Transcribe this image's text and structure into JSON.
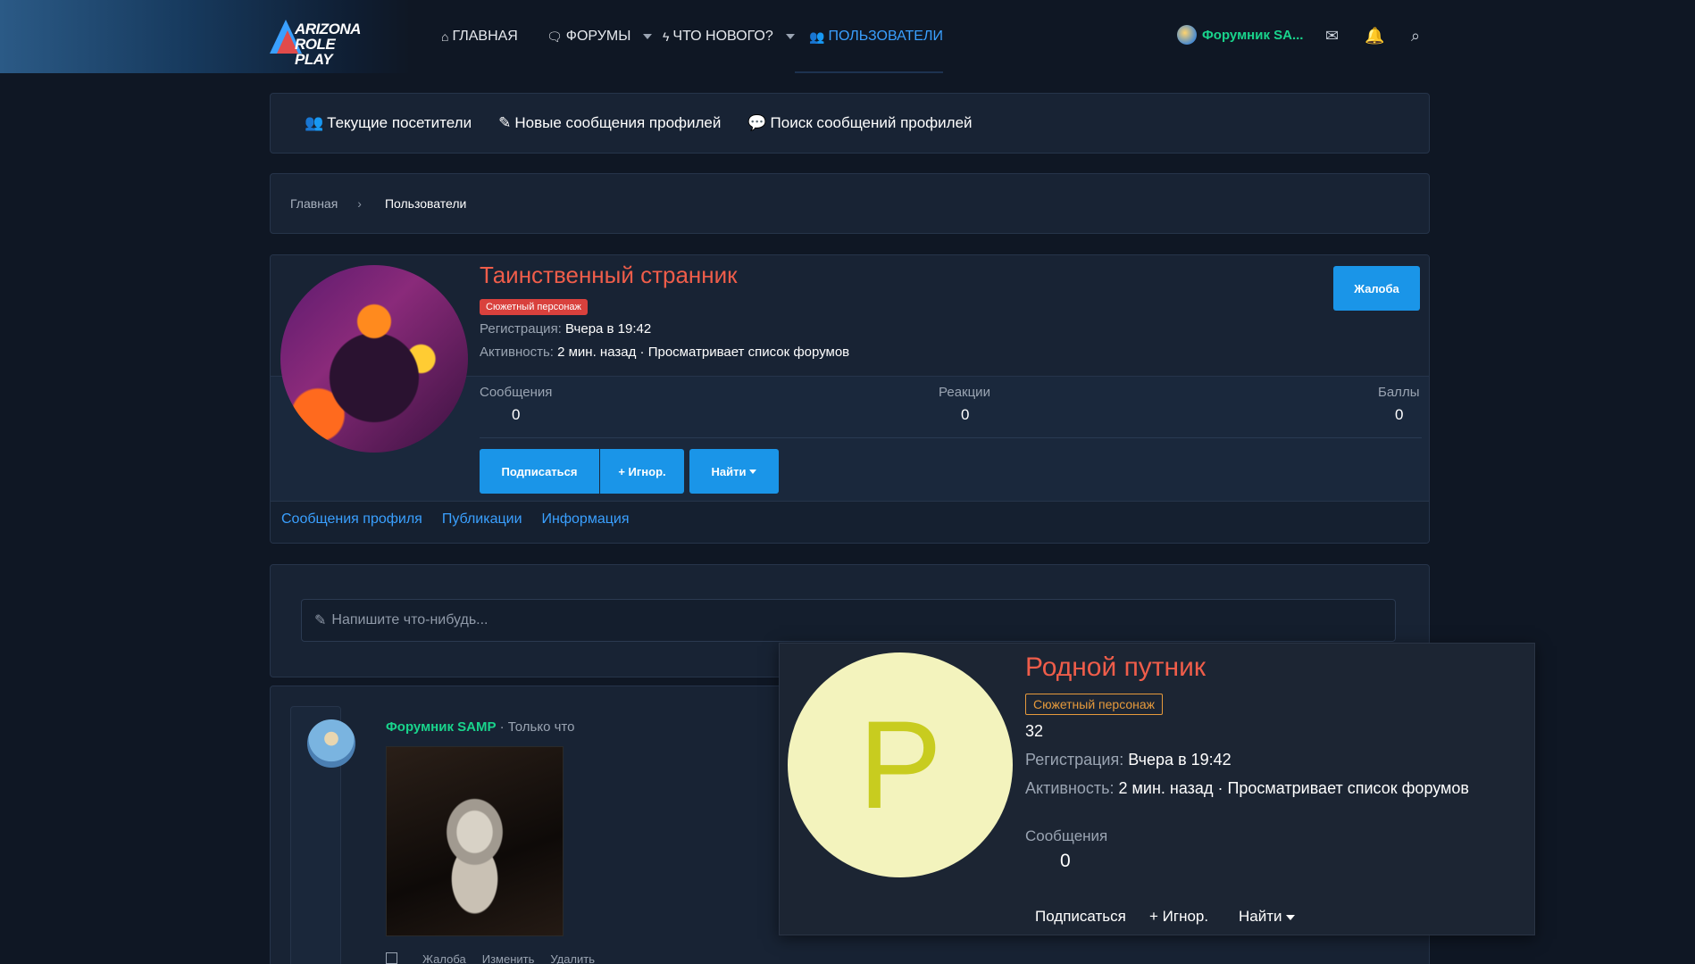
{
  "header": {
    "logo_line1": "ARIZONA",
    "logo_line2": "ROLE PLAY",
    "nav": [
      {
        "label": "ГЛАВНАЯ",
        "icon": "home-icon"
      },
      {
        "label": "ФОРУМЫ",
        "icon": "chat-icon"
      },
      {
        "label": "ЧТО НОВОГО?",
        "icon": "bolt-icon"
      },
      {
        "label": "ПОЛЬЗОВАТЕЛИ",
        "icon": "users-icon"
      }
    ],
    "user_name": "Форумник SA...",
    "accent_color": "#3aa0ff"
  },
  "subnav": [
    {
      "label": "Текущие посетители",
      "icon": "users-icon"
    },
    {
      "label": "Новые сообщения профилей",
      "icon": "pencil-icon"
    },
    {
      "label": "Поиск сообщений профилей",
      "icon": "comment-icon"
    }
  ],
  "breadcrumb": {
    "home": "Главная",
    "current": "Пользователи"
  },
  "profile": {
    "name": "Таинственный странник",
    "badge": "Сюжетный персонаж",
    "reg_label": "Регистрация:",
    "reg_value": "Вчера в 19:42",
    "act_label": "Активность:",
    "act_value": "2 мин. назад · Просматривает список форумов",
    "report": "Жалоба",
    "stats": [
      {
        "label": "Сообщения",
        "value": "0"
      },
      {
        "label": "Реакции",
        "value": "0"
      },
      {
        "label": "Баллы",
        "value": "0"
      }
    ],
    "buttons": {
      "follow": "Подписаться",
      "ignore": "+ Игнор.",
      "find": "Найти"
    },
    "tabs": [
      "Сообщения профиля",
      "Публикации",
      "Информация"
    ]
  },
  "composer": {
    "placeholder": "Напишите что-нибудь..."
  },
  "post": {
    "author": "Форумник SAMP",
    "time": "· Только что",
    "actions": [
      "Жалоба",
      "Изменить",
      "Удалить"
    ]
  },
  "tooltip": {
    "avatar_letter": "Р",
    "name": "Родной путник",
    "badge": "Сюжетный персонаж",
    "number": "32",
    "reg_label": "Регистрация:",
    "reg_value": "Вчера в 19:42",
    "act_label": "Активность:",
    "act_value": "2 мин. назад · Просматривает список форумов",
    "stat_label": "Сообщения",
    "stat_value": "0",
    "buttons": {
      "follow": "Подписаться",
      "ignore": "+ Игнор.",
      "find": "Найти"
    }
  }
}
